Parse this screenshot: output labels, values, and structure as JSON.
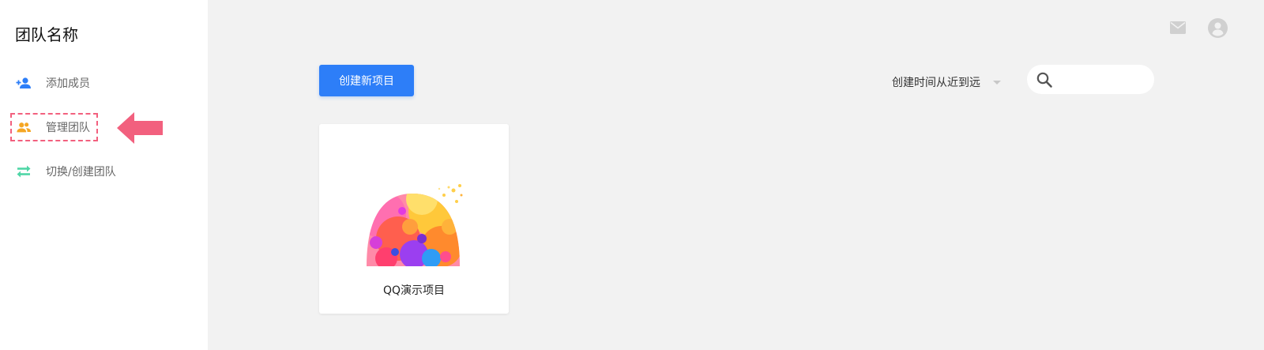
{
  "sidebar": {
    "team_name": "团队名称",
    "items": [
      {
        "label": "添加成员",
        "icon": "add-user-icon",
        "color": "#2d7ef8"
      },
      {
        "label": "管理团队",
        "icon": "group-icon",
        "color": "#f5a623",
        "highlighted": true
      },
      {
        "label": "切换/创建团队",
        "icon": "swap-icon",
        "color": "#4fd6a6"
      }
    ]
  },
  "header": {
    "icons": [
      "mail-icon",
      "account-icon"
    ]
  },
  "toolbar": {
    "create_label": "创建新项目",
    "sort_label": "创建时间从近到远",
    "search_placeholder": ""
  },
  "projects": [
    {
      "name": "QQ演示项目"
    }
  ],
  "colors": {
    "primary": "#2d7ef8",
    "annotation": "#f2607e",
    "background": "#f2f2f2"
  }
}
